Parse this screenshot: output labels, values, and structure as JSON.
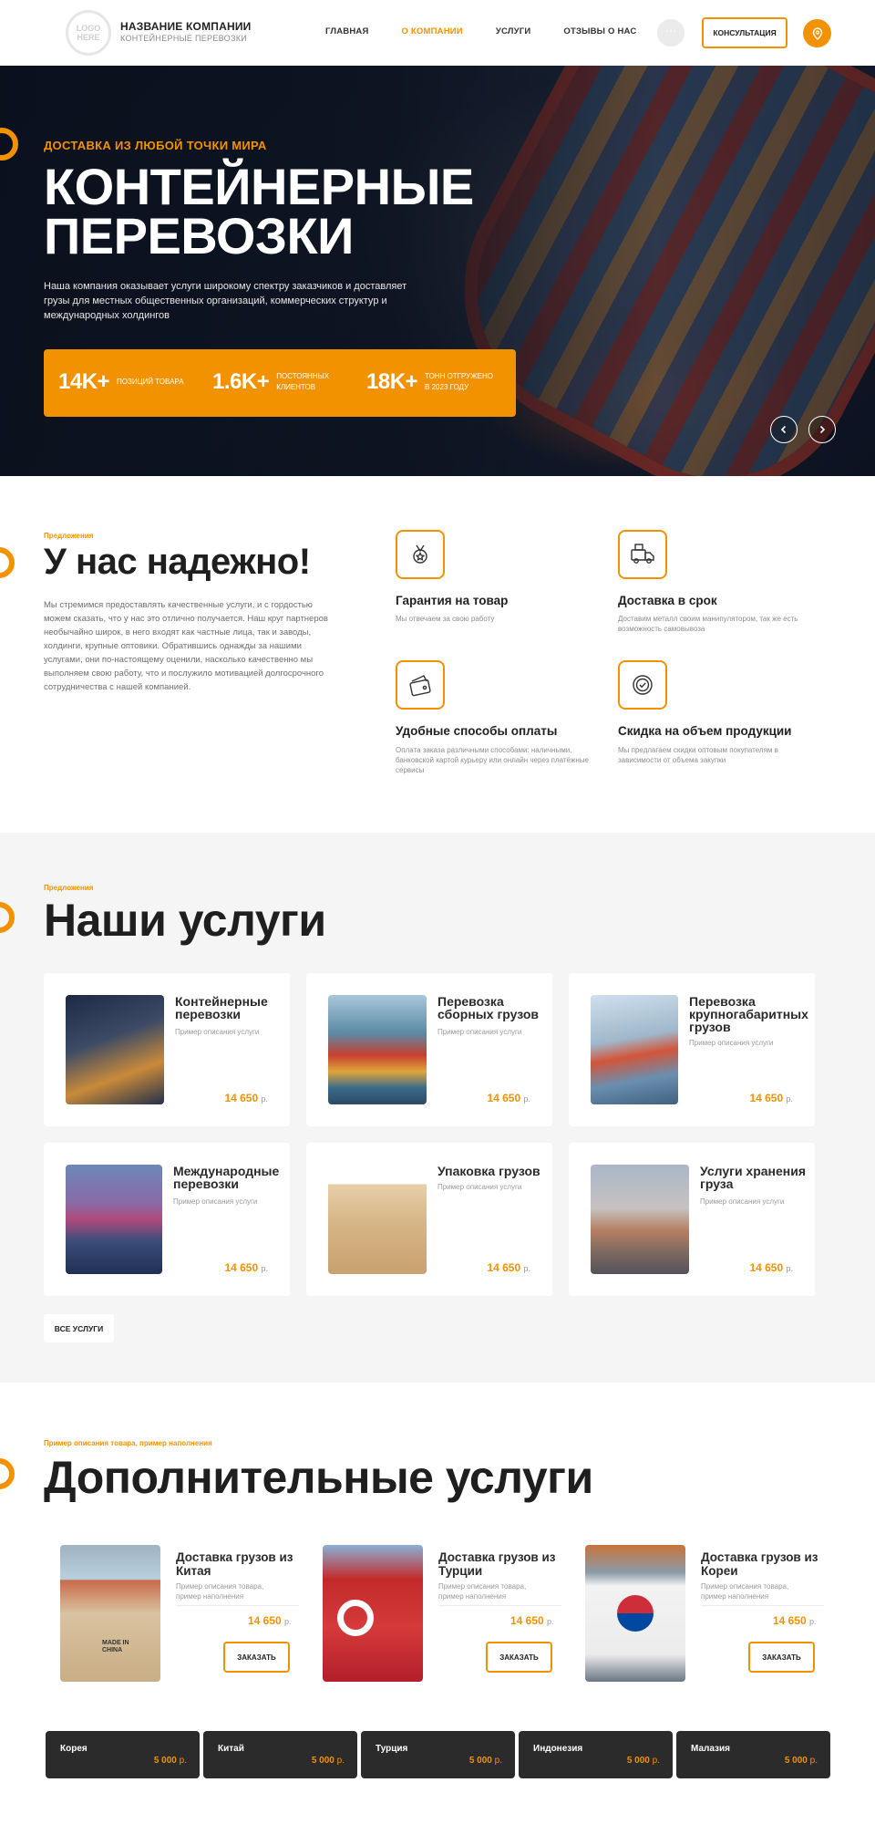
{
  "header": {
    "logo_line1": "LOGO",
    "logo_line2": "HERE",
    "company_name": "НАЗВАНИЕ КОМПАНИИ",
    "company_sub": "КОНТЕЙНЕРНЫЕ ПЕРЕВОЗКИ",
    "nav": [
      "ГЛАВНАЯ",
      "О КОМПАНИИ",
      "УСЛУГИ",
      "ОТЗЫВЫ О НАС"
    ],
    "nav_active": "О КОМПАНИИ",
    "more_label": "···",
    "consult_label": "КОНСУЛЬТАЦИЯ",
    "accent_color": "#f39200"
  },
  "hero": {
    "kicker": "ДОСТАВКА ИЗ ЛЮБОЙ ТОЧКИ МИРА",
    "title": "КОНТЕЙНЕРНЫЕ ПЕРЕВОЗКИ",
    "description": "Наша компания оказывает услуги широкому спектру заказчиков и доставляет грузы для местных общественных организаций, коммерческих структур и международных холдингов",
    "stats": [
      {
        "value": "14K+",
        "label": "ПОЗИЦИЙ ТОВАРА"
      },
      {
        "value": "1.6K+",
        "label": "ПОСТОЯННЫХ КЛИЕНТОВ"
      },
      {
        "value": "18K+",
        "label": "ТОНН ОТГРУЖЕНО В 2023 ГОДУ"
      }
    ]
  },
  "advantages": {
    "kicker": "Предложения",
    "title": "У нас надежно!",
    "text": "Мы стремимся предоставлять качественные услуги, и с гордостью можем сказать, что у нас это отлично получается. Наш круг партнеров необычайно широк, в него входят как частные лица, так и заводы, холдинги, крупные оптовики. Обратившись однажды за нашими услугами, они по-настоящему оценили, насколько качественно мы выполняем свою работу, что и послужило мотивацией долгосрочного сотрудничества с нашей компанией.",
    "features": [
      {
        "title": "Гарантия на товар",
        "desc": "Мы отвечаем за свою работу",
        "icon": "medal-icon"
      },
      {
        "title": "Доставка в срок",
        "desc": "Доставим металл своим манипулятором, так же есть возможность самовывоза",
        "icon": "delivery-truck-icon"
      },
      {
        "title": "Удобные способы оплаты",
        "desc": "Оплата заказа различными способами: наличными, банковской картой курьеру или онлайн через платёжные сервисы",
        "icon": "wallet-icon"
      },
      {
        "title": "Скидка на объем продукции",
        "desc": "Мы предлагаем скидки оптовым покупателям в зависимости от объема закупки",
        "icon": "discount-badge-icon"
      }
    ]
  },
  "services": {
    "kicker": "Предложения",
    "title": "Наши услуги",
    "items": [
      {
        "name": "Контейнерные перевозки",
        "desc": "Пример описания услуги",
        "price": "14 650",
        "currency": "р."
      },
      {
        "name": "Перевозка сборных грузов",
        "desc": "Пример описания услуги",
        "price": "14 650",
        "currency": "р."
      },
      {
        "name": "Перевозка крупногабаритных грузов",
        "desc": "Пример описания услуги",
        "price": "14 650",
        "currency": "р."
      },
      {
        "name": "Международные перевозки",
        "desc": "Пример описания услуги",
        "price": "14 650",
        "currency": "р."
      },
      {
        "name": "Упаковка грузов",
        "desc": "Пример описания услуги",
        "price": "14 650",
        "currency": "р."
      },
      {
        "name": "Услуги хранения груза",
        "desc": "Пример описания услуги",
        "price": "14 650",
        "currency": "р."
      }
    ],
    "all_label": "ВСЕ УСЛУГИ"
  },
  "extra": {
    "kicker": "Пример описания товара, пример наполнения",
    "title": "Дополнительные услуги",
    "items": [
      {
        "name": "Доставка грузов из Китая",
        "desc": "Пример описания товара, пример наполнения",
        "price": "14 650",
        "currency": "р.",
        "button": "ЗАКАЗАТЬ",
        "image_text": "MADE IN CHINA"
      },
      {
        "name": "Доставка грузов из Турции",
        "desc": "Пример описания товара, пример наполнения",
        "price": "14 650",
        "currency": "р.",
        "button": "ЗАКАЗАТЬ"
      },
      {
        "name": "Доставка грузов из Кореи",
        "desc": "Пример описания товара, пример наполнения",
        "price": "14 650",
        "currency": "р.",
        "button": "ЗАКАЗАТЬ"
      }
    ],
    "countries": [
      {
        "name": "Корея",
        "price": "5 000",
        "currency": "р."
      },
      {
        "name": "Китай",
        "price": "5 000",
        "currency": "р."
      },
      {
        "name": "Турция",
        "price": "5 000",
        "currency": "р."
      },
      {
        "name": "Индонезия",
        "price": "5 000",
        "currency": "р."
      },
      {
        "name": "Малазия",
        "price": "5 000",
        "currency": "р."
      }
    ]
  }
}
